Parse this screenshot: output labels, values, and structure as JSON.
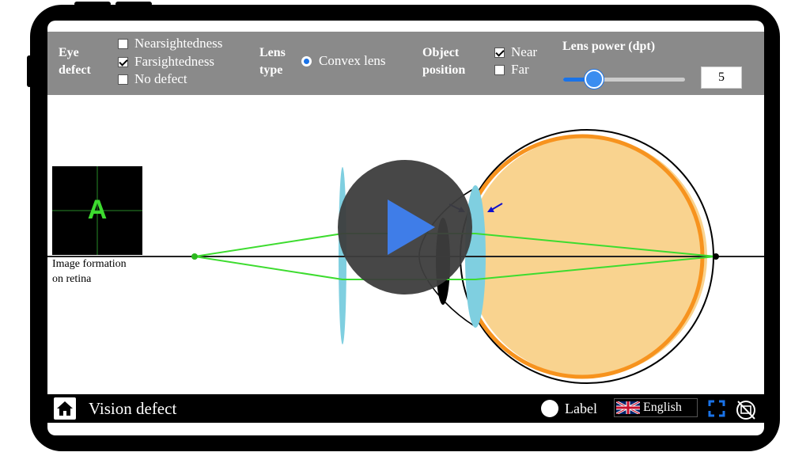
{
  "toolbar": {
    "eye_defect_label": [
      "Eye",
      "defect"
    ],
    "defect_options": [
      {
        "label": "Nearsightedness",
        "checked": false
      },
      {
        "label": "Farsightedness",
        "checked": true
      },
      {
        "label": "No defect",
        "checked": false
      }
    ],
    "lens_type_label": [
      "Lens",
      "type"
    ],
    "lens_option": {
      "label": "Convex lens",
      "selected": true
    },
    "object_position_label": [
      "Object",
      "position"
    ],
    "position_options": [
      {
        "label": "Near",
        "checked": true
      },
      {
        "label": "Far",
        "checked": false
      }
    ],
    "lens_power_label": "Lens power (dpt)",
    "lens_power_value": "5",
    "lens_power_fraction": 0.25
  },
  "retina_view": {
    "letter": "A",
    "caption": [
      "Image formation",
      "on retina"
    ]
  },
  "bottom_bar": {
    "title": "Vision defect",
    "label_toggle": "Label",
    "language": "English"
  },
  "icons": [
    "home-icon",
    "play-icon",
    "fullscreen-icon",
    "hide-video-icon",
    "uk-flag-icon"
  ],
  "colors": {
    "toolbar_bg": "#8a8a8a",
    "eye_fill": "#f9d38f",
    "retina_orange": "#f7931e",
    "lens_blue": "#7fcfe0",
    "ray_green": "#3ddc2f",
    "accent_blue": "#1a73e8"
  }
}
